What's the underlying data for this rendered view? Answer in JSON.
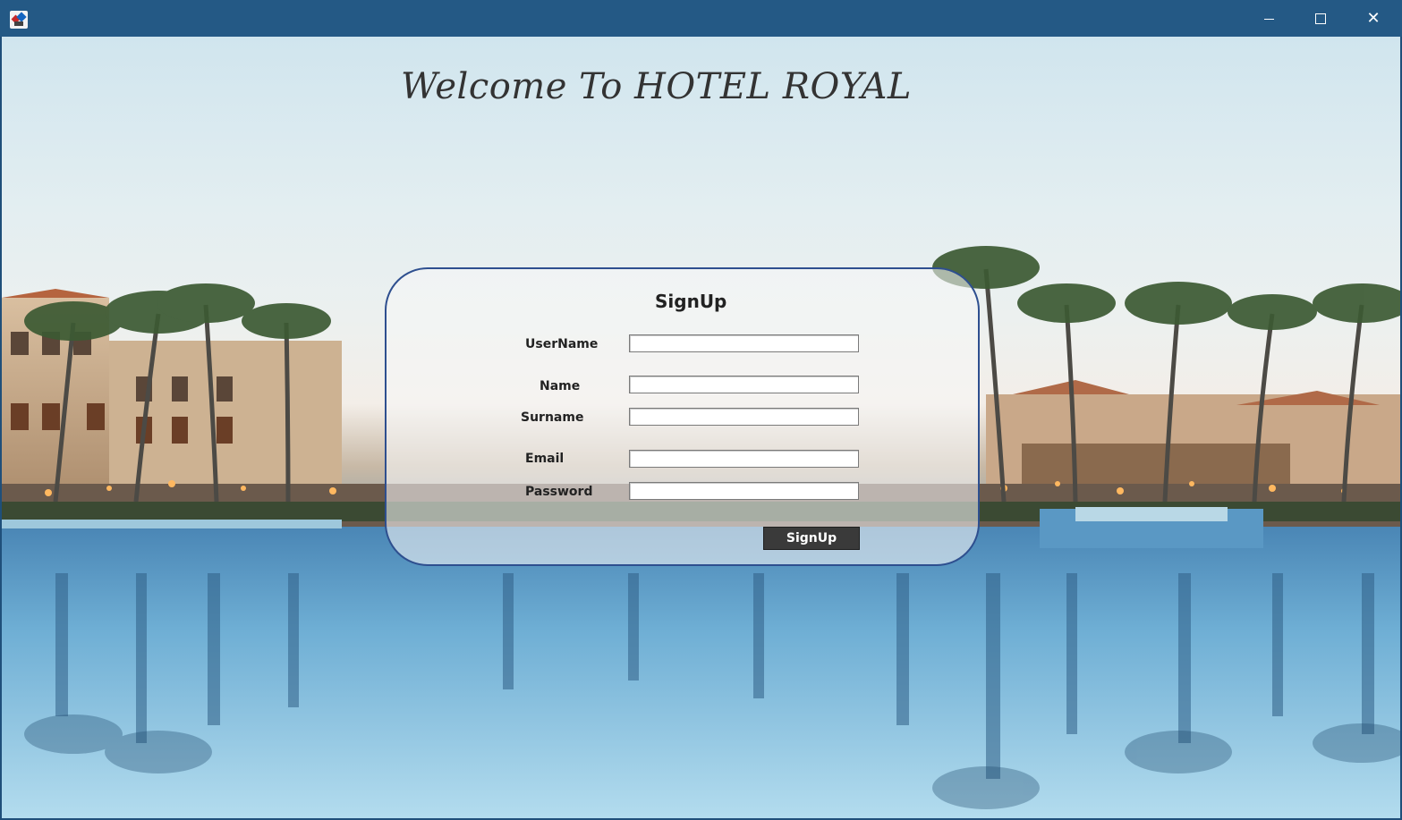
{
  "window": {
    "icon": "java-app-icon",
    "controls": {
      "minimize_icon": "minimize-icon",
      "maximize_icon": "maximize-icon",
      "close_icon": "close-icon",
      "close_glyph": "✕"
    }
  },
  "header": {
    "welcome_text": "Welcome To HOTEL ROYAL"
  },
  "signup_form": {
    "title": "SignUp",
    "fields": [
      {
        "label": "UserName",
        "value": ""
      },
      {
        "label": "Name",
        "value": ""
      },
      {
        "label": "Surname",
        "value": ""
      },
      {
        "label": "Email",
        "value": ""
      },
      {
        "label": "Password",
        "value": ""
      }
    ],
    "submit_label": "SignUp"
  },
  "colors": {
    "titlebar": "#245985",
    "panel_border": "#2e4f8f",
    "button_bg": "#3a3a3a",
    "title_text": "#333333"
  }
}
